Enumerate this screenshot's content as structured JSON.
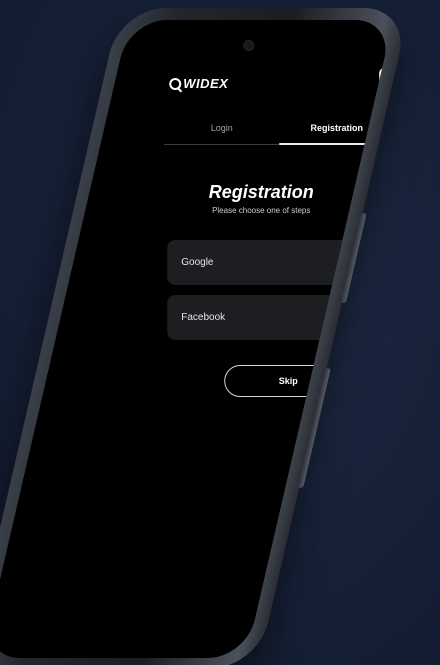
{
  "app": {
    "brand": "WIDEX"
  },
  "tabs": [
    {
      "label": "Login",
      "active": false
    },
    {
      "label": "Registration",
      "active": true
    }
  ],
  "main": {
    "title": "Registration",
    "subtitle": "Please choose one of steps"
  },
  "options": [
    {
      "label": "Google",
      "icon": "google-icon"
    },
    {
      "label": "Facebook",
      "icon": "facebook-icon"
    }
  ],
  "actions": {
    "skip_label": "Skip"
  },
  "colors": {
    "background": "#162037",
    "screen": "#000000",
    "card": "#1d1e21",
    "menu_accent": "#2c6bd8",
    "facebook": "#1877f2"
  }
}
